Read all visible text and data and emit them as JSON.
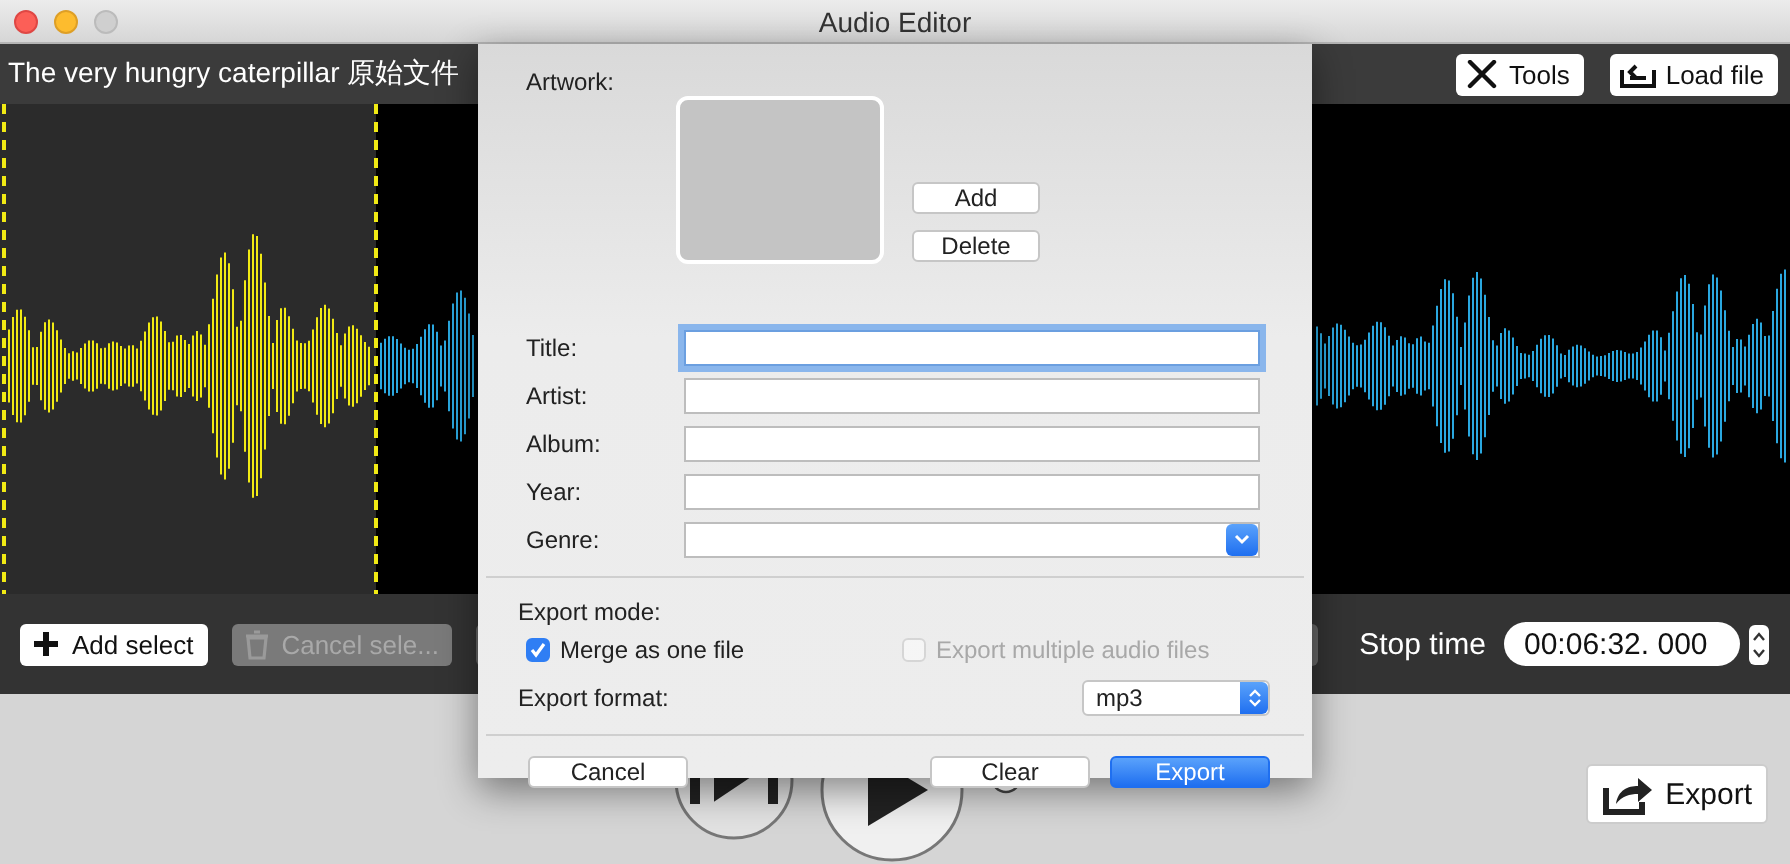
{
  "window": {
    "title": "Audio Editor"
  },
  "file_title": "The very hungry caterpillar 原始文件",
  "toolbar_buttons": [
    {
      "label": "Tools",
      "kind": "tools"
    },
    {
      "label": "Load file",
      "kind": "load"
    }
  ],
  "selection_controls": [
    {
      "label": "Add select",
      "kind": "add",
      "disabled": false
    },
    {
      "label": "Cancel sele...",
      "kind": "delete",
      "disabled": true
    }
  ],
  "stop_time": {
    "label": "Stop time",
    "value": "00:06:32. 000"
  },
  "playback_radio": {
    "checked": false
  },
  "export_button": {
    "label": "Export"
  },
  "dialog": {
    "artwork_label": "Artwork:",
    "artwork_buttons": [
      "Add",
      "Delete"
    ],
    "fields": [
      {
        "label": "Title:",
        "kind": "text",
        "focused": true
      },
      {
        "label": "Artist:",
        "kind": "text",
        "focused": false
      },
      {
        "label": "Album:",
        "kind": "text",
        "focused": false
      },
      {
        "label": "Year:",
        "kind": "text",
        "focused": false
      },
      {
        "label": "Genre:",
        "kind": "combo",
        "focused": false
      }
    ],
    "export_mode": {
      "label": "Export mode:",
      "options": [
        {
          "label": "Merge as one file",
          "checked": true,
          "disabled": false
        },
        {
          "label": "Export multiple audio files",
          "checked": false,
          "disabled": true
        }
      ]
    },
    "export_format": {
      "label": "Export format:",
      "value": "mp3"
    },
    "buttons": [
      {
        "label": "Cancel",
        "kind": "default"
      },
      {
        "label": "Clear",
        "kind": "default"
      },
      {
        "label": "Export",
        "kind": "primary"
      }
    ]
  }
}
